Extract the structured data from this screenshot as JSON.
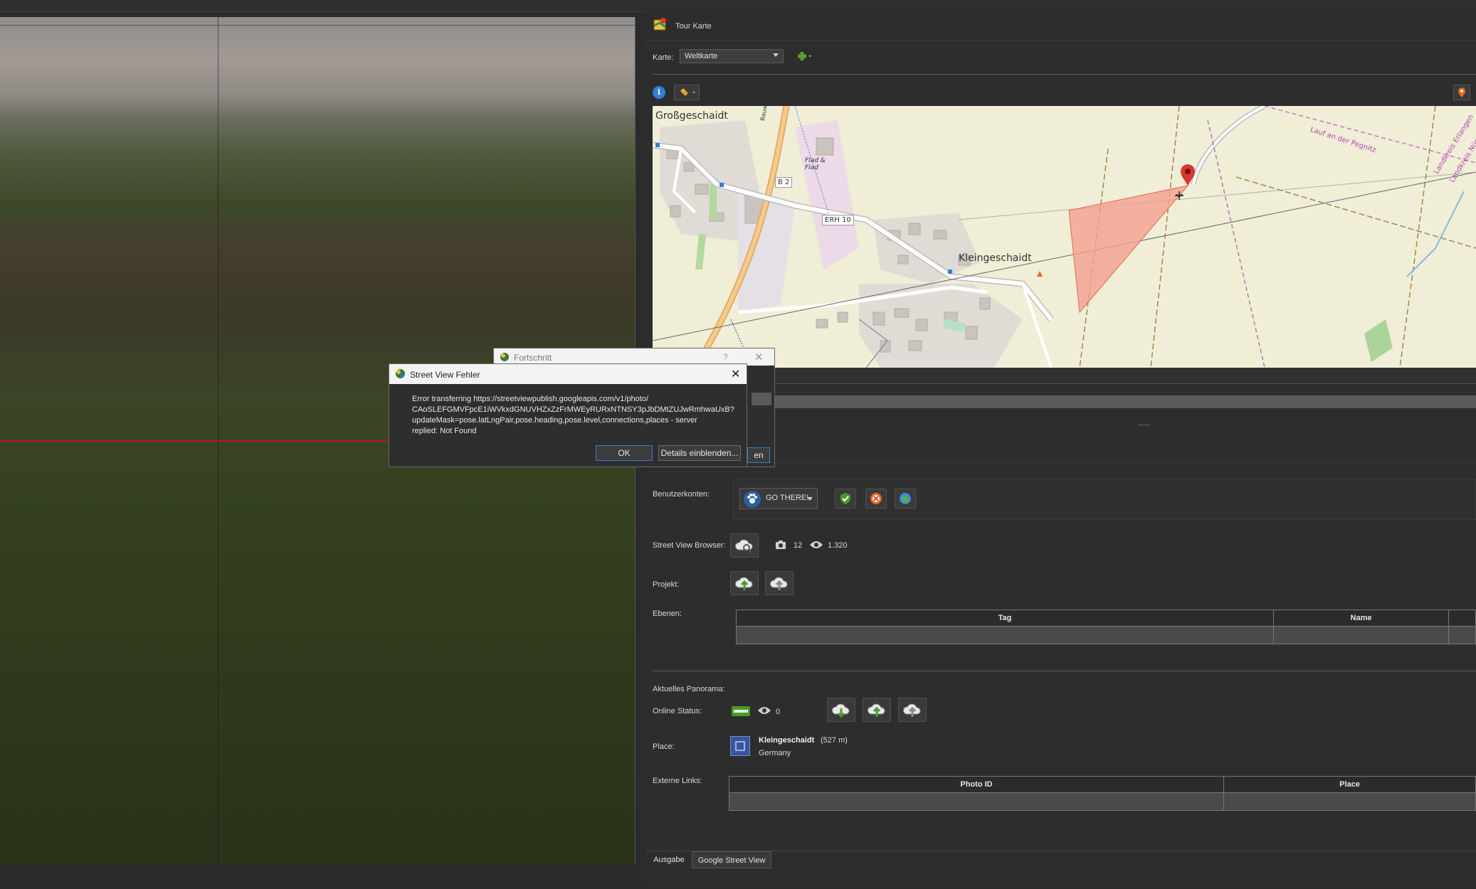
{
  "panel": {
    "title": "Tour Karte",
    "karte_label": "Karte:",
    "karte_value": "Weltkarte"
  },
  "map": {
    "labels": {
      "grossgeschaidt": "Großgeschaidt",
      "kleingeschaidt": "Kleingeschaidt",
      "b2": "B 2",
      "erh10": "ERH 10",
      "flad": "Flad & Flad",
      "lauf": "Lauf an der Pegnitz",
      "landkreis": "Landkreis Erlangen",
      "landkreis2": "Landkreis Nürn",
      "bauweg": "Bauweg"
    }
  },
  "accounts": {
    "label": "Benutzerkonten:",
    "selected": "GO THERE!"
  },
  "browser": {
    "label": "Street View Browser:",
    "photos": "12",
    "views": "1.320"
  },
  "project": {
    "label": "Projekt:"
  },
  "layers": {
    "label": "Ebenen:",
    "columns": [
      "Tag",
      "Name"
    ]
  },
  "current": {
    "label": "Aktuelles Panorama:",
    "online_label": "Online Status:",
    "online_views": "0",
    "place_label": "Place:",
    "place_name": "Kleingeschaidt",
    "place_alt": "(527 m)",
    "place_country": "Germany",
    "links_label": "Externe Links:",
    "links_columns": [
      "Photo ID",
      "Place"
    ]
  },
  "progress_dialog": {
    "title": "Fortschritt",
    "help": "?",
    "button_partial": "en"
  },
  "error_dialog": {
    "title": "Street View Fehler",
    "message_lines": [
      "Error transferring https://streetviewpublish.googleapis.com/v1/photo/",
      "CAoSLEFGMVFpcE1iWVkxdGNUVHZxZzFrMWEyRURxNTNSY3pJbDMtZUJwRmhwaUxB?",
      "updateMask=pose.latLngPair,pose.heading,pose.level,connections,places - server",
      "replied: Not Found"
    ],
    "ok": "OK",
    "details": "Details einblenden..."
  },
  "bottom_tabs": [
    "Ausgabe",
    "Google Street View"
  ],
  "colors": {
    "accent_green": "#5aa02c",
    "map_pin": "#d63a2f",
    "fov_fill": "#f4a090"
  }
}
